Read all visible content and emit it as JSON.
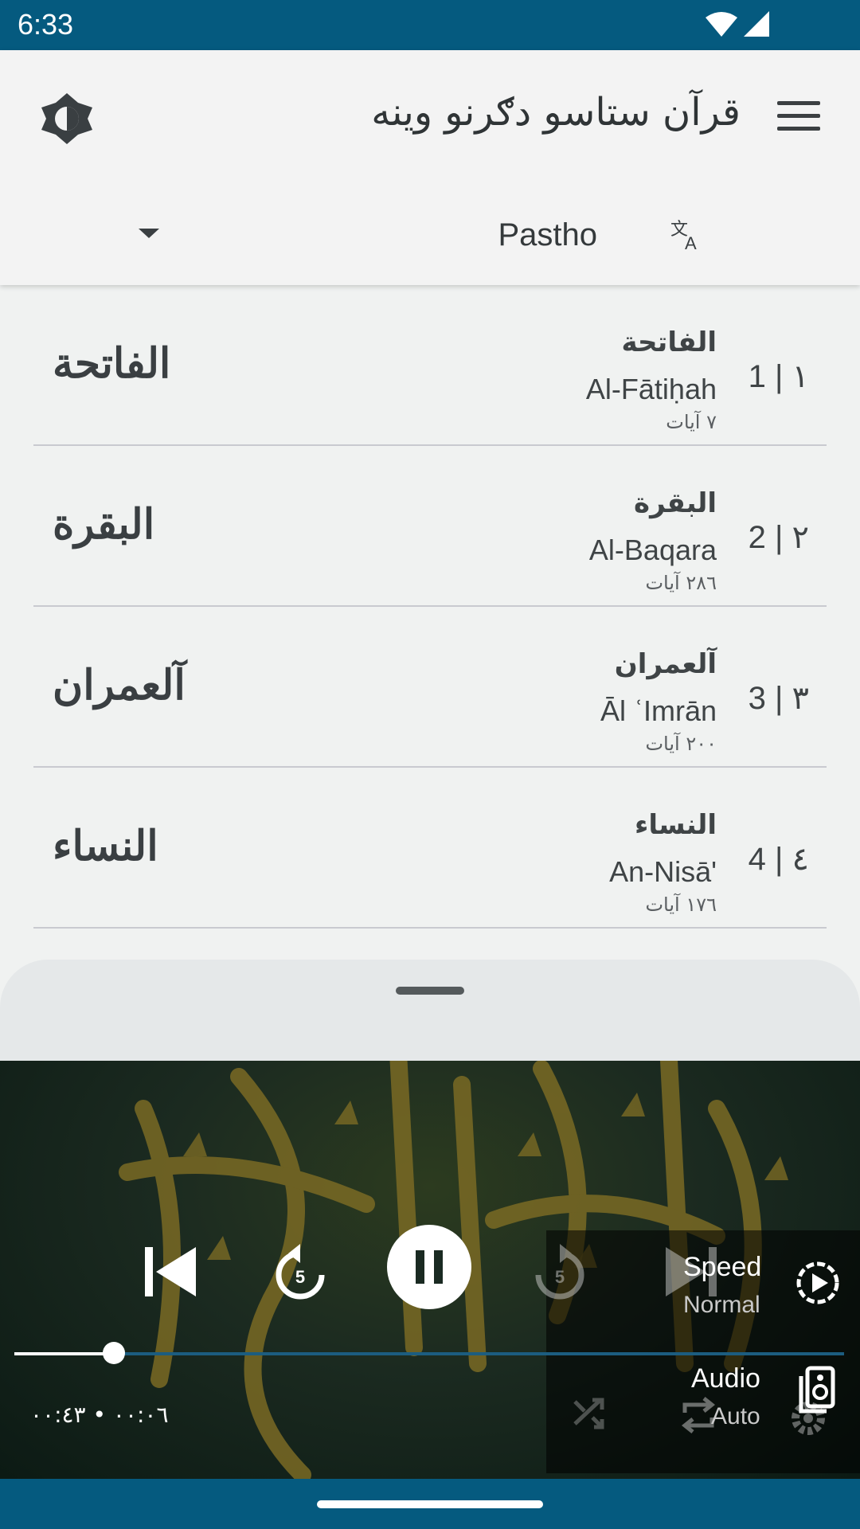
{
  "status_bar": {
    "time": "6:33"
  },
  "app_bar": {
    "title": "قرآن ستاسو دګرنو وینه",
    "language": "Pastho"
  },
  "surahs": [
    {
      "num": "1 | ١",
      "name_ar": "الفاتحة",
      "translit": "Al-Fātiḥah",
      "ayat": "٧ آيات",
      "calligraphy": "الفاتحة"
    },
    {
      "num": "2 | ٢",
      "name_ar": "البقرة",
      "translit": "Al-Baqara",
      "ayat": "٢٨٦ آيات",
      "calligraphy": "البقرة"
    },
    {
      "num": "3 | ٣",
      "name_ar": "آلعمران",
      "translit": "Āl ʿImrān",
      "ayat": "٢٠٠ آيات",
      "calligraphy": "آلعمران"
    },
    {
      "num": "4 | ٤",
      "name_ar": "النساء",
      "translit": "An-Nisā'",
      "ayat": "١٧٦ آيات",
      "calligraphy": "النساء"
    }
  ],
  "player": {
    "speed_label": "Speed",
    "speed_value": "Normal",
    "audio_label": "Audio",
    "audio_value": "Auto",
    "rewind_seconds": "5",
    "forward_seconds": "5",
    "time_readout": "٠٠:٠٦ • ٠٠:٤٣",
    "progress_fraction": 0.12
  },
  "colors": {
    "status_bar": "#055a7f",
    "accent": "#1c5d80"
  }
}
